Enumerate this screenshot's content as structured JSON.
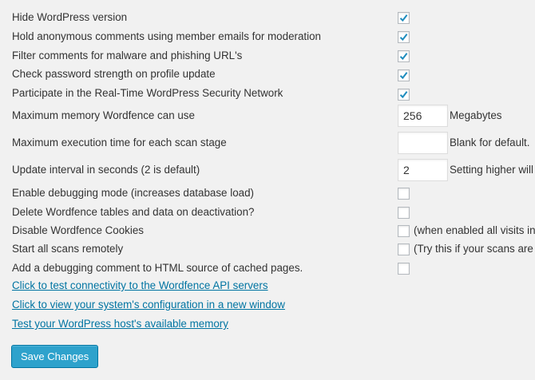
{
  "settings": {
    "hide_wp_version": {
      "label": "Hide WordPress version",
      "checked": true
    },
    "hold_anon_comments": {
      "label": "Hold anonymous comments using member emails for moderation",
      "checked": true
    },
    "filter_comments": {
      "label": "Filter comments for malware and phishing URL's",
      "checked": true
    },
    "check_password": {
      "label": "Check password strength on profile update",
      "checked": true
    },
    "participate_network": {
      "label": "Participate in the Real-Time WordPress Security Network",
      "checked": true
    },
    "max_memory": {
      "label": "Maximum memory Wordfence can use",
      "value": "256",
      "suffix": "Megabytes"
    },
    "max_exec_time": {
      "label": "Maximum execution time for each scan stage",
      "value": "",
      "suffix": "Blank for default."
    },
    "update_interval": {
      "label": "Update interval in seconds (2 is default)",
      "value": "2",
      "suffix": "Setting higher will"
    },
    "debugging_mode": {
      "label": "Enable debugging mode (increases database load)",
      "checked": false
    },
    "delete_tables": {
      "label": "Delete Wordfence tables and data on deactivation?",
      "checked": false
    },
    "disable_cookies": {
      "label": "Disable Wordfence Cookies",
      "checked": false,
      "note": "(when enabled all visits in"
    },
    "start_scans_remotely": {
      "label": "Start all scans remotely",
      "checked": false,
      "note": "(Try this if your scans are"
    },
    "debug_comment": {
      "label": "Add a debugging comment to HTML source of cached pages.",
      "checked": false
    }
  },
  "links": {
    "test_connectivity": "Click to test connectivity to the Wordfence API servers",
    "view_config": "Click to view your system's configuration in a new window",
    "test_memory": "Test your WordPress host's available memory"
  },
  "save_button": "Save Changes",
  "colors": {
    "background": "#f1f1f1",
    "link": "#0074a2",
    "button": "#2ea2cc",
    "check": "#1e8cbe"
  }
}
